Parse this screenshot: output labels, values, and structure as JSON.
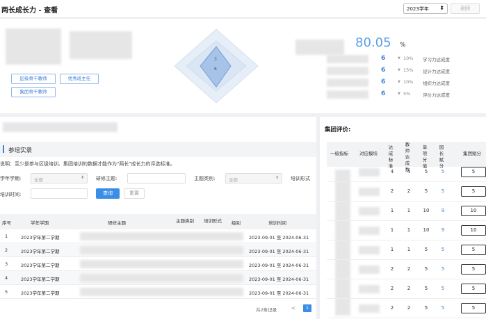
{
  "header": {
    "title": "两长成长力 - 查看",
    "year_value": "2023学年",
    "back_label": "返回"
  },
  "summary": {
    "tags": [
      "区级骨干教师",
      "优秀班主任",
      "集团骨干教师"
    ],
    "radar_labels": [
      "3",
      "6"
    ],
    "score": "80.05",
    "score_unit": "%",
    "metrics": [
      {
        "value": "6",
        "pct": "10%",
        "label": "学习力达成度"
      },
      {
        "value": "6",
        "pct": "15%",
        "label": "设计力达成度"
      },
      {
        "value": "6",
        "pct": "10%",
        "label": "组织力达成度"
      },
      {
        "value": "6",
        "pct": "5%",
        "label": "评价力达成度"
      }
    ],
    "colors": {
      "accent": "#3b7ed6",
      "score": "#5aa0e6"
    }
  },
  "training": {
    "section_title": "参培实录",
    "note": "说明：至少是参与区级培训、集团培训的数据才能作为\"两长\"成长力的评选标准。",
    "filters": {
      "year_label": "学年学期:",
      "year_placeholder": "全部",
      "theme_label": "研修主题:",
      "type_label": "主题类别:",
      "type_placeholder": "全部",
      "form_label": "培训形式",
      "time_label": "培训时间:"
    },
    "query_label": "查询",
    "reset_label": "重置",
    "columns": [
      "序号",
      "学年学期",
      "研修主题",
      "主题类别",
      "培训形式",
      "级别",
      "培训时间"
    ],
    "rows": [
      {
        "no": "1",
        "term": "2023学年第二学期",
        "time": "2023-09-01  至  2024-06-31"
      },
      {
        "no": "2",
        "term": "2023学年第二学期",
        "time": "2023-09-01  至  2024-06-31"
      },
      {
        "no": "3",
        "term": "2023学年第二学期",
        "time": "2023-09-01  至  2024-06-31"
      },
      {
        "no": "4",
        "term": "2023学年第二学期",
        "time": "2023-09-01  至  2024-06-31"
      },
      {
        "no": "5",
        "term": "2023学年第二学期",
        "time": "2023-09-01  至  2024-06-31"
      }
    ],
    "pager": {
      "total": "共2条记录",
      "prev": "<",
      "page": "1"
    }
  },
  "group_eval": {
    "title": "集团评价:",
    "columns": [
      "一级指标",
      "对应模块",
      "达成标准",
      "教师达成数",
      "单项分值",
      "园长赋分",
      "集团赋分"
    ],
    "rows": [
      {
        "standard": "4",
        "count": "4",
        "score": "5",
        "principal": "5",
        "group": "5"
      },
      {
        "standard": "2",
        "count": "2",
        "score": "5",
        "principal": "5",
        "group": "5"
      },
      {
        "standard": "1",
        "count": "1",
        "score": "10",
        "principal": "9",
        "group": "10"
      },
      {
        "standard": "1",
        "count": "1",
        "score": "10",
        "principal": "9",
        "group": "10"
      },
      {
        "standard": "1",
        "count": "1",
        "score": "5",
        "principal": "5",
        "group": "5"
      },
      {
        "standard": "2",
        "count": "2",
        "score": "5",
        "principal": "5",
        "group": "5"
      },
      {
        "standard": "2",
        "count": "2",
        "score": "5",
        "principal": "5",
        "group": "5"
      },
      {
        "standard": "2",
        "count": "2",
        "score": "5",
        "principal": "5",
        "group": "5"
      }
    ]
  }
}
